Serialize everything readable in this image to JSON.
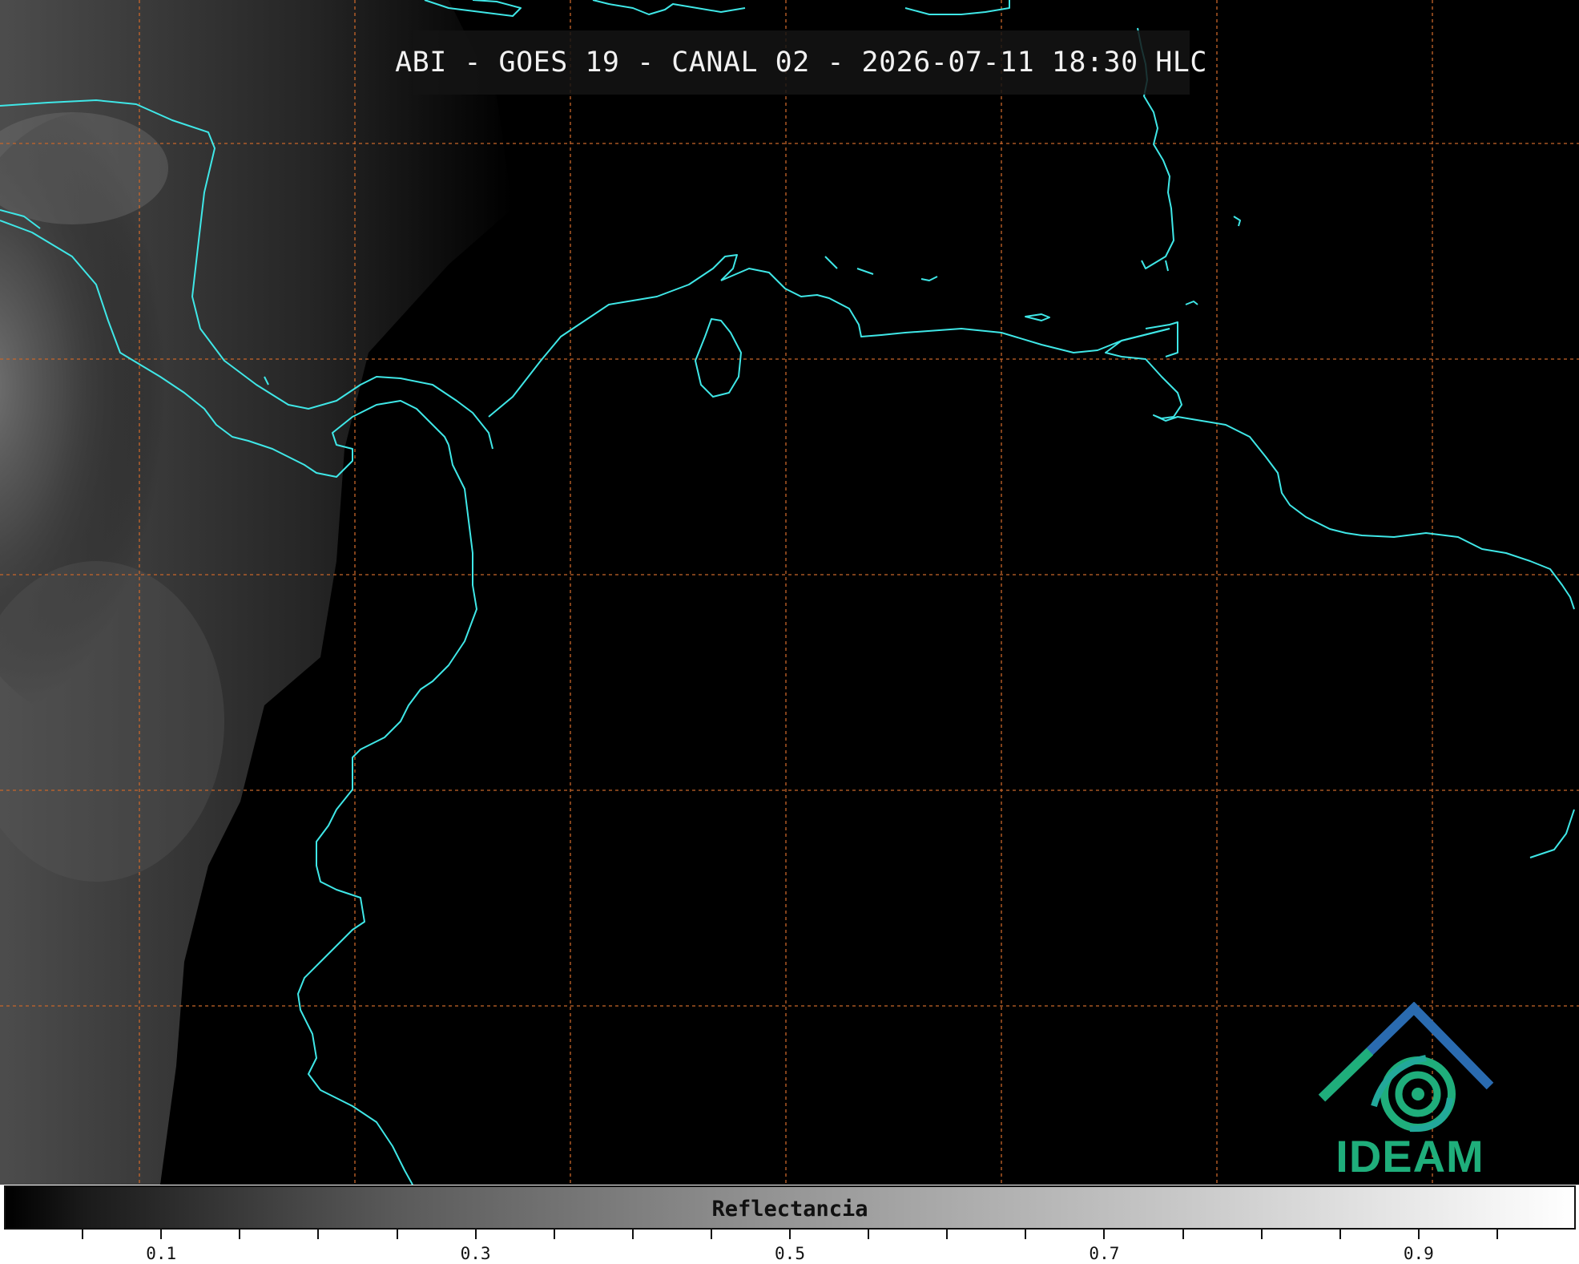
{
  "map": {
    "title": "ABI - GOES 19 - CANAL 02 - 2026-07-11 18:30 HLC",
    "coastline_color": "#3fe7e7",
    "gridline_color": "#c8662a",
    "background_color": "#000000"
  },
  "logo": {
    "text": "IDEAM",
    "icon": "ideam-logo-icon",
    "colors": [
      "#2a5fa8",
      "#1fae7b"
    ]
  },
  "colorbar": {
    "label": "Reflectancia",
    "range": [
      0,
      1
    ],
    "tick_labels": [
      "0.1",
      "0.3",
      "0.5",
      "0.7",
      "0.9"
    ],
    "tick_values": [
      0.1,
      0.3,
      0.5,
      0.7,
      0.9
    ],
    "minor_step": 0.05
  }
}
